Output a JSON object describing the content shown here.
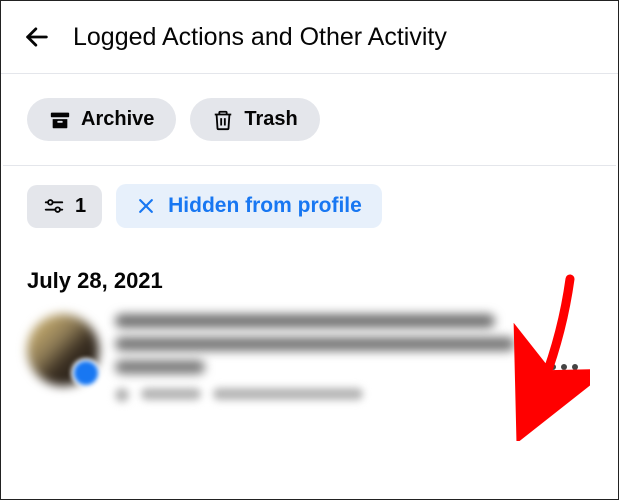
{
  "header": {
    "title": "Logged Actions and Other Activity"
  },
  "toolbar": {
    "archive_label": "Archive",
    "trash_label": "Trash"
  },
  "filters": {
    "count": "1",
    "active": "Hidden from profile"
  },
  "section": {
    "date": "July 28, 2021"
  }
}
